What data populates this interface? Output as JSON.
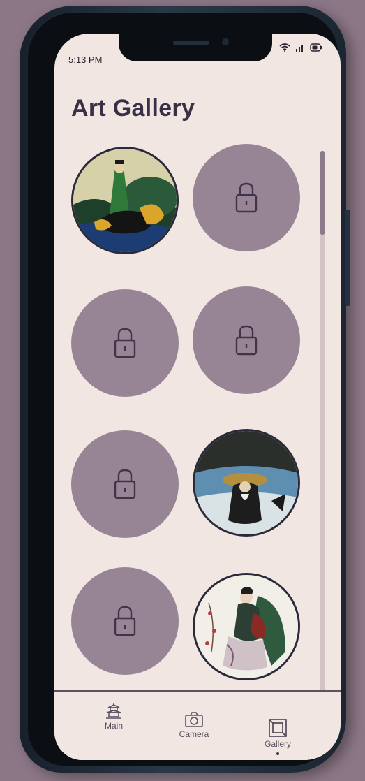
{
  "status_bar": {
    "time": "5:13 PM"
  },
  "header": {
    "title": "Art Gallery"
  },
  "gallery": {
    "tiles": [
      {
        "state": "unlocked",
        "artwork": "warrior-on-horse-painting"
      },
      {
        "state": "locked",
        "icon": "lock-icon"
      },
      {
        "state": "locked",
        "icon": "lock-icon"
      },
      {
        "state": "locked",
        "icon": "lock-icon"
      },
      {
        "state": "locked",
        "icon": "lock-icon"
      },
      {
        "state": "unlocked",
        "artwork": "seated-sage-painting"
      },
      {
        "state": "locked",
        "icon": "lock-icon"
      },
      {
        "state": "unlocked",
        "artwork": "woman-with-lute-painting"
      }
    ]
  },
  "bottom_nav": {
    "items": [
      {
        "label": "Main",
        "icon": "pagoda-icon"
      },
      {
        "label": "Camera",
        "icon": "camera-icon"
      },
      {
        "label": "Gallery",
        "icon": "gallery-icon",
        "active": true
      }
    ]
  },
  "colors": {
    "background": "#8c7787",
    "screen": "#f1e6e2",
    "locked_tile": "#978596",
    "title": "#3a3046"
  }
}
